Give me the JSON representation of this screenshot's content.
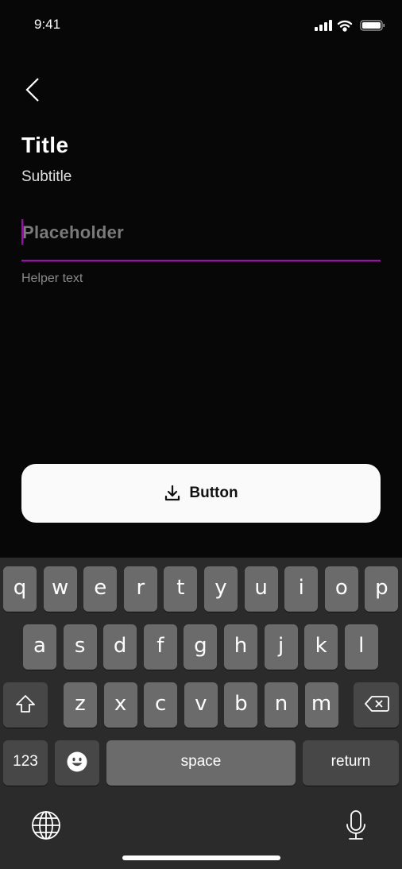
{
  "status_bar": {
    "time": "9:41",
    "icons": [
      "signal-icon",
      "wifi-icon",
      "battery-icon"
    ]
  },
  "header": {
    "back_icon": "chevron-left-icon",
    "title": "Title",
    "subtitle": "Subtitle"
  },
  "input": {
    "placeholder": "Placeholder",
    "value": "",
    "helper": "Helper text",
    "accent": "#b000c0"
  },
  "button": {
    "icon": "download-icon",
    "label": "Button"
  },
  "keyboard": {
    "row1": [
      "q",
      "w",
      "e",
      "r",
      "t",
      "y",
      "u",
      "i",
      "o",
      "p"
    ],
    "row2": [
      "a",
      "s",
      "d",
      "f",
      "g",
      "h",
      "j",
      "k",
      "l"
    ],
    "row3": [
      "z",
      "x",
      "c",
      "v",
      "b",
      "n",
      "m"
    ],
    "numbers": "123",
    "space": "space",
    "return": "return"
  }
}
